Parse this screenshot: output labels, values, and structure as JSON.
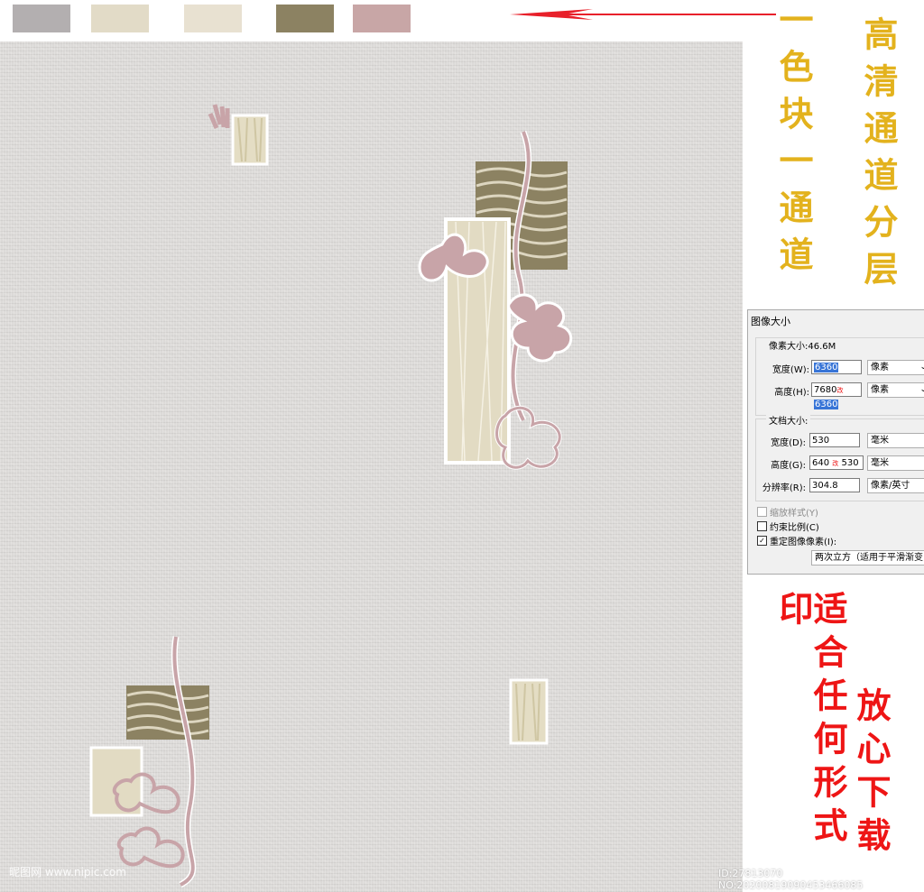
{
  "swatches": [
    {
      "color": "#b3afb0"
    },
    {
      "color": "#e2dbc7"
    },
    {
      "color": "#e8e1d1"
    },
    {
      "color": "#8c8262"
    },
    {
      "color": "#c8a6a6"
    }
  ],
  "annotations": {
    "col1": "一色块一通道",
    "col2": "高清通道分层",
    "red1": "适合任何形式印",
    "red2": "放心下载"
  },
  "dialog": {
    "title": "图像大小",
    "pixel_dims_label": "像素大小:46.6M",
    "width_label": "宽度(W):",
    "width_value": "6360",
    "width_unit": "像素",
    "height_label": "高度(H):",
    "height_value": "7680",
    "height_arrow": "改",
    "height_new": "6360",
    "height_unit": "像素",
    "doc_size_label": "文档大小:",
    "doc_width_label": "宽度(D):",
    "doc_width_value": "530",
    "doc_width_unit": "毫米",
    "doc_height_label": "高度(G):",
    "doc_height_value": "640",
    "doc_height_arrow": "改",
    "doc_height_new": "530",
    "doc_height_unit": "毫米",
    "resolution_label": "分辨率(R):",
    "resolution_value": "304.8",
    "resolution_unit": "像素/英寸",
    "scale_styles": "缩放样式(Y)",
    "constrain": "约束比例(C)",
    "resample": "重定图像像素(I):",
    "resample_method": "两次立方（适用于平滑渐变"
  },
  "watermark": {
    "left": "昵图网 www.nipic.com",
    "right": "ID:27813070 NO:20200819090453466085"
  }
}
